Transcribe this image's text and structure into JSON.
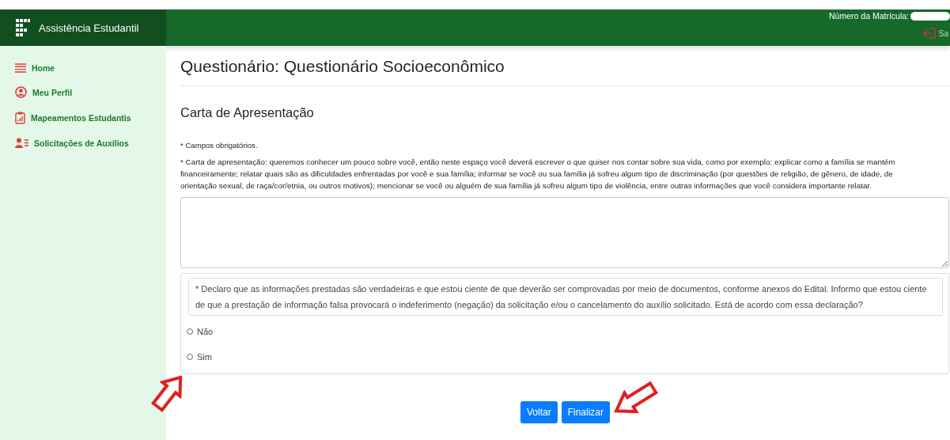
{
  "app": {
    "title": "Assistência Estudantil"
  },
  "header": {
    "registration_label": "Número da Matrícula:",
    "exit_label": "Sa"
  },
  "sidebar": {
    "items": [
      {
        "label": "Home"
      },
      {
        "label": "Meu Perfil"
      },
      {
        "label": "Mapeamentos Estudantis"
      },
      {
        "label": "Solicitações de Auxílios"
      }
    ]
  },
  "page": {
    "title": "Questionário: Questionário Socioeconômico",
    "section": "Carta de Apresentação",
    "required_note": "* Campos obrigatórios.",
    "letter_prompt": "* Carta de apresentação: queremos conhecer um pouco sobre você, então neste espaço você deverá escrever o que quiser nos contar sobre sua vida, como por exemplo: explicar como a família se mantém financeiramente; relatar quais são as dificuldades enfrentadas por você e sua família; informar se você ou sua família já sofreu algum tipo de discriminação (por questões de religião, de gênero, de idade, de orientação sexual, de raça/cor/etnia, ou outros motivos); mencionar se você ou alguém de sua família já sofreu algum tipo de violência, entre outras informações que você considera importante relatar.",
    "declaration": "* Declaro que as informações prestadas são verdadeiras e que estou ciente de que deverão ser comprovadas por meio de documentos, conforme anexos do Edital. Informo que estou ciente de que a prestação de informação falsa provocará o indeferimento (negação) da solicitação e/ou o cancelamento do auxílio solicitado. Está de acordo com essa declaração?",
    "options": [
      {
        "label": "Não",
        "selected": false
      },
      {
        "label": "Sim",
        "selected": false
      }
    ],
    "buttons": [
      "Voltar",
      "Finalizar"
    ]
  }
}
